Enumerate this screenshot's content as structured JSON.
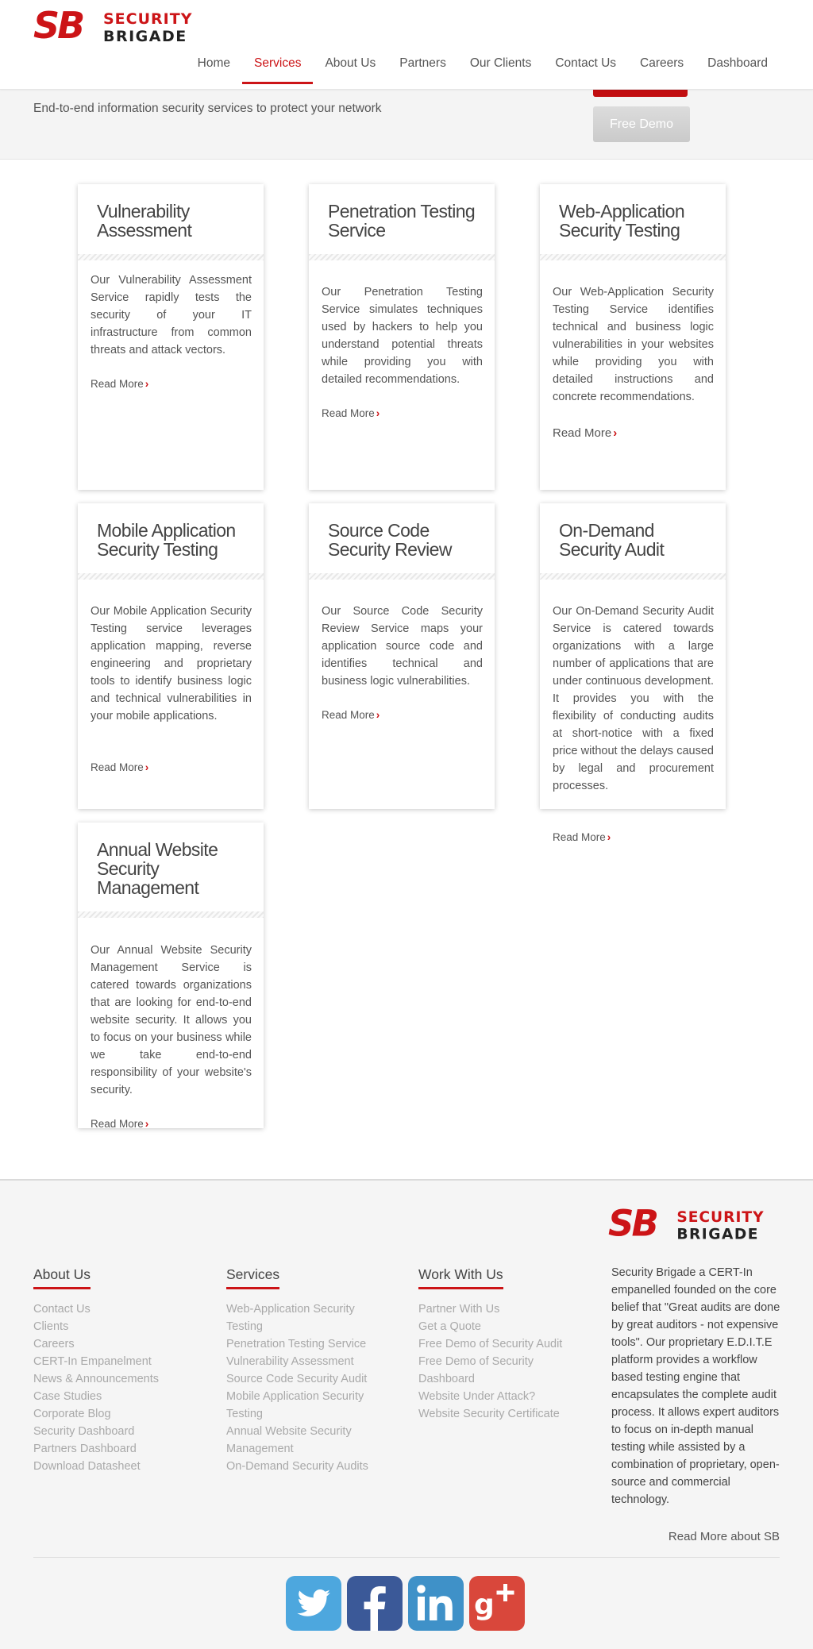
{
  "brand": {
    "top_word": "SECURITY",
    "bottom_word": "BRIGADE",
    "mark": "SB",
    "red": "#cc1417"
  },
  "nav": [
    {
      "label": "Home",
      "active": false
    },
    {
      "label": "Services",
      "active": true
    },
    {
      "label": "About Us",
      "active": false
    },
    {
      "label": "Partners",
      "active": false
    },
    {
      "label": "Our Clients",
      "active": false
    },
    {
      "label": "Contact Us",
      "active": false
    },
    {
      "label": "Careers",
      "active": false
    },
    {
      "label": "Dashboard",
      "active": false
    }
  ],
  "hero": {
    "subtitle": "End-to-end information security services to protect your network",
    "demo_button": "Free Demo"
  },
  "cards": [
    {
      "title": "Vulnerability Assessment",
      "description": "Our Vulnerability Assessment Service rapidly tests the security of your IT infrastructure from common threats and attack vectors.",
      "read_more": "Read More"
    },
    {
      "title": "Penetration Testing Service",
      "description": "Our Penetration Testing Service simulates techniques used by hackers to help you understand potential threats while providing you with detailed recommendations.",
      "read_more": "Read More"
    },
    {
      "title": "Web-Application Security Testing",
      "description": "Our Web-Application Security Testing Service identifies technical and business logic vulnerabilities in your websites while providing you with detailed instructions and concrete recommendations.",
      "read_more": "Read More"
    },
    {
      "title": "Mobile Application Security Testing",
      "description": "Our Mobile Application Security Testing service leverages application mapping, reverse engineering and proprietary tools to identify business logic and technical vulnerabilities in your mobile applications.",
      "read_more": "Read More"
    },
    {
      "title": "Source Code Security Review",
      "description": "Our Source Code Security Review Service maps your application source code and identifies technical and business logic vulnerabilities.",
      "read_more": "Read More"
    },
    {
      "title": "On-Demand Security Audit",
      "description": "Our On-Demand Security Audit Service is catered towards organizations with a large number of applications that are under continuous development. It provides you with the flexibility of conducting audits at short-notice with a fixed price without the delays caused by legal and procurement processes.",
      "read_more": "Read More"
    },
    {
      "title": "Annual Website Security Management",
      "description": "Our Annual Website Security Management Service is catered towards organizations that are looking for end-to-end website security. It allows you to focus on your business while we take end-to-end responsibility of your website's security.",
      "read_more": "Read More"
    }
  ],
  "footer": {
    "columns": [
      {
        "title": "About Us",
        "links": [
          "Contact Us",
          "Clients",
          "Careers",
          "CERT-In Empanelment",
          "News & Announcements",
          "Case Studies",
          "Corporate Blog",
          "Security Dashboard",
          "Partners Dashboard",
          "Download Datasheet"
        ]
      },
      {
        "title": "Services",
        "links": [
          "Web-Application Security Testing",
          "Penetration Testing Service",
          "Vulnerability Assessment",
          "Source Code Security Audit",
          "Mobile Application Security Testing",
          "Annual Website Security Management",
          "On-Demand Security Audits"
        ]
      },
      {
        "title": "Work With Us",
        "links": [
          "Partner With Us",
          "Get a Quote",
          "Free Demo of Security Audit",
          "Free Demo of Security Dashboard",
          "Website Under Attack?",
          "Website Security Certificate"
        ]
      }
    ],
    "about_text": "Security Brigade a CERT-In empanelled founded on the core belief that \"Great audits are done by great auditors - not expensive tools\". Our proprietary E.D.I.T.E platform provides a workflow based testing engine that encapsulates the complete audit process. It allows expert auditors to focus on in-depth manual testing while assisted by a combination of proprietary, open-source and commercial technology.",
    "read_more": "Read More about SB",
    "social": [
      {
        "name": "twitter-icon",
        "color": "#4da7de"
      },
      {
        "name": "facebook-icon",
        "color": "#3b5998"
      },
      {
        "name": "linkedin-icon",
        "color": "#3f91c8"
      },
      {
        "name": "google-plus-icon",
        "color": "#d9473b"
      }
    ]
  }
}
